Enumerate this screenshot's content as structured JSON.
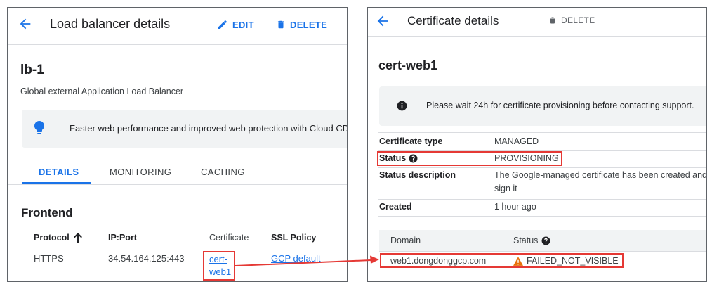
{
  "left": {
    "title": "Load balancer details",
    "edit_label": "EDIT",
    "delete_label": "DELETE",
    "name": "lb-1",
    "type": "Global external Application Load Balancer",
    "banner_text": "Faster web performance and improved web protection with Cloud CDN",
    "tabs": [
      "DETAILS",
      "MONITORING",
      "CACHING"
    ],
    "frontend": {
      "title": "Frontend",
      "headers": [
        "Protocol",
        "IP:Port",
        "Certificate",
        "SSL Policy"
      ],
      "row": {
        "protocol": "HTTPS",
        "ip_port": "34.54.164.125:443",
        "certificate_line1": "cert-",
        "certificate_line2": "web1",
        "ssl_policy": "GCP default"
      }
    }
  },
  "right": {
    "title": "Certificate details",
    "delete_label": "DELETE",
    "name": "cert-web1",
    "banner_text": "Please wait 24h for certificate provisioning before contacting support.",
    "fields": [
      {
        "key": "Certificate type",
        "value": "MANAGED"
      },
      {
        "key": "Status",
        "value": "PROVISIONING"
      },
      {
        "key": "Status description",
        "value": "The Google-managed certificate has been created and is waiting to",
        "value_line2": "sign it"
      },
      {
        "key": "Created",
        "value": "1 hour ago"
      }
    ],
    "domains": {
      "headers": [
        "Domain",
        "Status"
      ],
      "row": {
        "domain": "web1.dongdonggcp.com",
        "status": "FAILED_NOT_VISIBLE"
      }
    }
  },
  "colors": {
    "accent": "#1a73e8",
    "highlight": "#e53935",
    "warning": "#e8710a",
    "banner_bg": "#f1f3f4"
  }
}
